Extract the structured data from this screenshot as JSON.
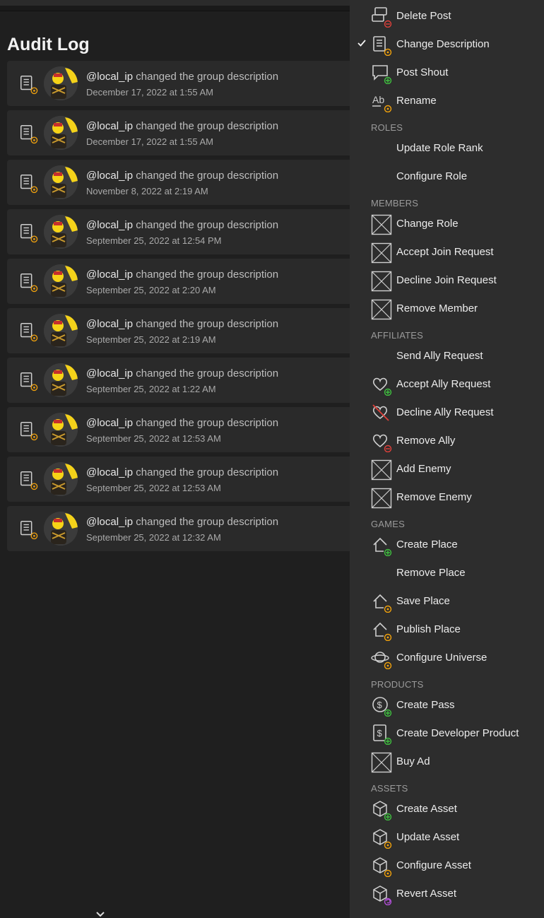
{
  "page": {
    "title": "Audit Log"
  },
  "entries": [
    {
      "user": "@local_ip",
      "action": "changed the group description",
      "time": "December 17, 2022 at 1:55 AM"
    },
    {
      "user": "@local_ip",
      "action": "changed the group description",
      "time": "December 17, 2022 at 1:55 AM"
    },
    {
      "user": "@local_ip",
      "action": "changed the group description",
      "time": "November 8, 2022 at 2:19 AM"
    },
    {
      "user": "@local_ip",
      "action": "changed the group description",
      "time": "September 25, 2022 at 12:54 PM"
    },
    {
      "user": "@local_ip",
      "action": "changed the group description",
      "time": "September 25, 2022 at 2:20 AM"
    },
    {
      "user": "@local_ip",
      "action": "changed the group description",
      "time": "September 25, 2022 at 2:19 AM"
    },
    {
      "user": "@local_ip",
      "action": "changed the group description",
      "time": "September 25, 2022 at 1:22 AM"
    },
    {
      "user": "@local_ip",
      "action": "changed the group description",
      "time": "September 25, 2022 at 12:53 AM"
    },
    {
      "user": "@local_ip",
      "action": "changed the group description",
      "time": "September 25, 2022 at 12:53 AM"
    },
    {
      "user": "@local_ip",
      "action": "changed the group description",
      "time": "September 25, 2022 at 12:32 AM"
    }
  ],
  "menu": {
    "sections": [
      {
        "label": ""
      },
      {
        "label": "ROLES"
      },
      {
        "label": "MEMBERS"
      },
      {
        "label": "AFFILIATES"
      },
      {
        "label": "GAMES"
      },
      {
        "label": "PRODUCTS"
      },
      {
        "label": "ASSETS"
      }
    ],
    "items": [
      {
        "label": "Delete Post",
        "icon": "post-delete-icon",
        "checked": false
      },
      {
        "label": "Change Description",
        "icon": "document-icon",
        "checked": true
      },
      {
        "label": "Post Shout",
        "icon": "shout-add-icon",
        "checked": false
      },
      {
        "label": "Rename",
        "icon": "rename-icon",
        "checked": false
      },
      {
        "label": "Update Role Rank",
        "icon": "",
        "checked": false
      },
      {
        "label": "Configure Role",
        "icon": "",
        "checked": false
      },
      {
        "label": "Change Role",
        "icon": "placeholder-icon",
        "checked": false
      },
      {
        "label": "Accept Join Request",
        "icon": "placeholder-icon",
        "checked": false
      },
      {
        "label": "Decline Join Request",
        "icon": "placeholder-icon",
        "checked": false
      },
      {
        "label": "Remove Member",
        "icon": "placeholder-icon",
        "checked": false
      },
      {
        "label": "Send Ally Request",
        "icon": "",
        "checked": false
      },
      {
        "label": "Accept Ally Request",
        "icon": "heart-add-icon",
        "checked": false
      },
      {
        "label": "Decline Ally Request",
        "icon": "heart-broken-icon",
        "checked": false
      },
      {
        "label": "Remove Ally",
        "icon": "heart-remove-icon",
        "checked": false
      },
      {
        "label": "Add Enemy",
        "icon": "placeholder-icon",
        "checked": false
      },
      {
        "label": "Remove Enemy",
        "icon": "placeholder-icon",
        "checked": false
      },
      {
        "label": "Create Place",
        "icon": "house-add-icon",
        "checked": false
      },
      {
        "label": "Remove Place",
        "icon": "",
        "checked": false
      },
      {
        "label": "Save Place",
        "icon": "house-gear-icon",
        "checked": false
      },
      {
        "label": "Publish Place",
        "icon": "house-gear-icon",
        "checked": false
      },
      {
        "label": "Configure Universe",
        "icon": "planet-gear-icon",
        "checked": false
      },
      {
        "label": "Create Pass",
        "icon": "coin-add-icon",
        "checked": false
      },
      {
        "label": "Create Developer Product",
        "icon": "dollar-doc-add-icon",
        "checked": false
      },
      {
        "label": "Buy Ad",
        "icon": "placeholder-icon",
        "checked": false
      },
      {
        "label": "Create Asset",
        "icon": "box-add-icon",
        "checked": false
      },
      {
        "label": "Update Asset",
        "icon": "box-gear-icon",
        "checked": false
      },
      {
        "label": "Configure Asset",
        "icon": "box-gear-icon",
        "checked": false
      },
      {
        "label": "Revert Asset",
        "icon": "box-revert-icon",
        "checked": false
      }
    ]
  },
  "colors": {
    "add": "#3fbf3f",
    "remove": "#e0403a",
    "gear": "#f2a20c",
    "revert": "#b04fd6"
  }
}
